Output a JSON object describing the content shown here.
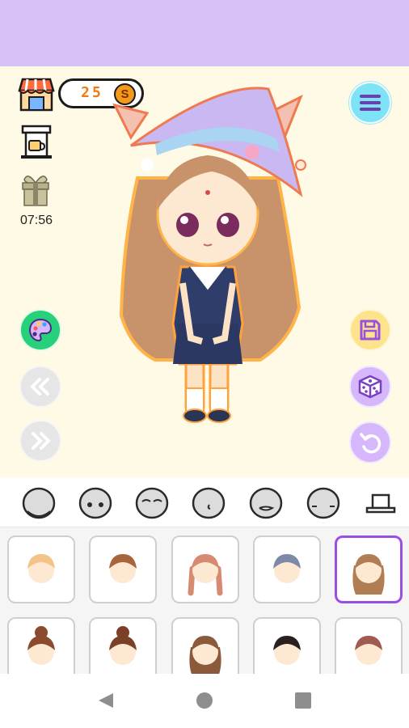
{
  "status": {
    "coins": "25",
    "coin_symbol": "S",
    "gift_timer": "07:56"
  },
  "colors": {
    "header": "#d7bff8",
    "stage_bg": "#fffae6",
    "menu_button": "#7fe3f6",
    "palette_button": "#27d07a",
    "save_button": "#fde48c",
    "action_buttons": "#d7b7fb",
    "selected_border": "#9a4fe0"
  },
  "toolbar": {
    "left": [
      "shop-icon",
      "machine-icon",
      "gift-icon",
      "palette-icon",
      "prev-icon",
      "next-icon"
    ],
    "right": [
      "menu-icon",
      "save-icon",
      "dice-icon",
      "undo-icon"
    ]
  },
  "categories": [
    {
      "name": "face-base-icon"
    },
    {
      "name": "eyes-icon"
    },
    {
      "name": "eyebrows-icon"
    },
    {
      "name": "nose-icon"
    },
    {
      "name": "mouth-icon"
    },
    {
      "name": "blush-icon"
    },
    {
      "name": "hat-icon"
    }
  ],
  "items": [
    {
      "name": "hair-1",
      "hair": "#f3c488",
      "style": "short",
      "selected": false
    },
    {
      "name": "hair-2",
      "hair": "#a8643a",
      "style": "short",
      "selected": false
    },
    {
      "name": "hair-3",
      "hair": "#d68a72",
      "style": "braids",
      "selected": false
    },
    {
      "name": "hair-4",
      "hair": "#7c8aa6",
      "style": "short",
      "selected": false
    },
    {
      "name": "hair-5",
      "hair": "#b07d55",
      "style": "long",
      "selected": true
    },
    {
      "name": "hair-6",
      "hair": "#8a4b2e",
      "style": "bun",
      "selected": false
    },
    {
      "name": "hair-7",
      "hair": "#7a4028",
      "style": "bun",
      "selected": false
    },
    {
      "name": "hair-8",
      "hair": "#8a5a3a",
      "style": "long",
      "selected": false
    },
    {
      "name": "hair-9",
      "hair": "#2a2020",
      "style": "short",
      "selected": false
    },
    {
      "name": "hair-10",
      "hair": "#a05a50",
      "style": "short",
      "selected": false
    }
  ]
}
